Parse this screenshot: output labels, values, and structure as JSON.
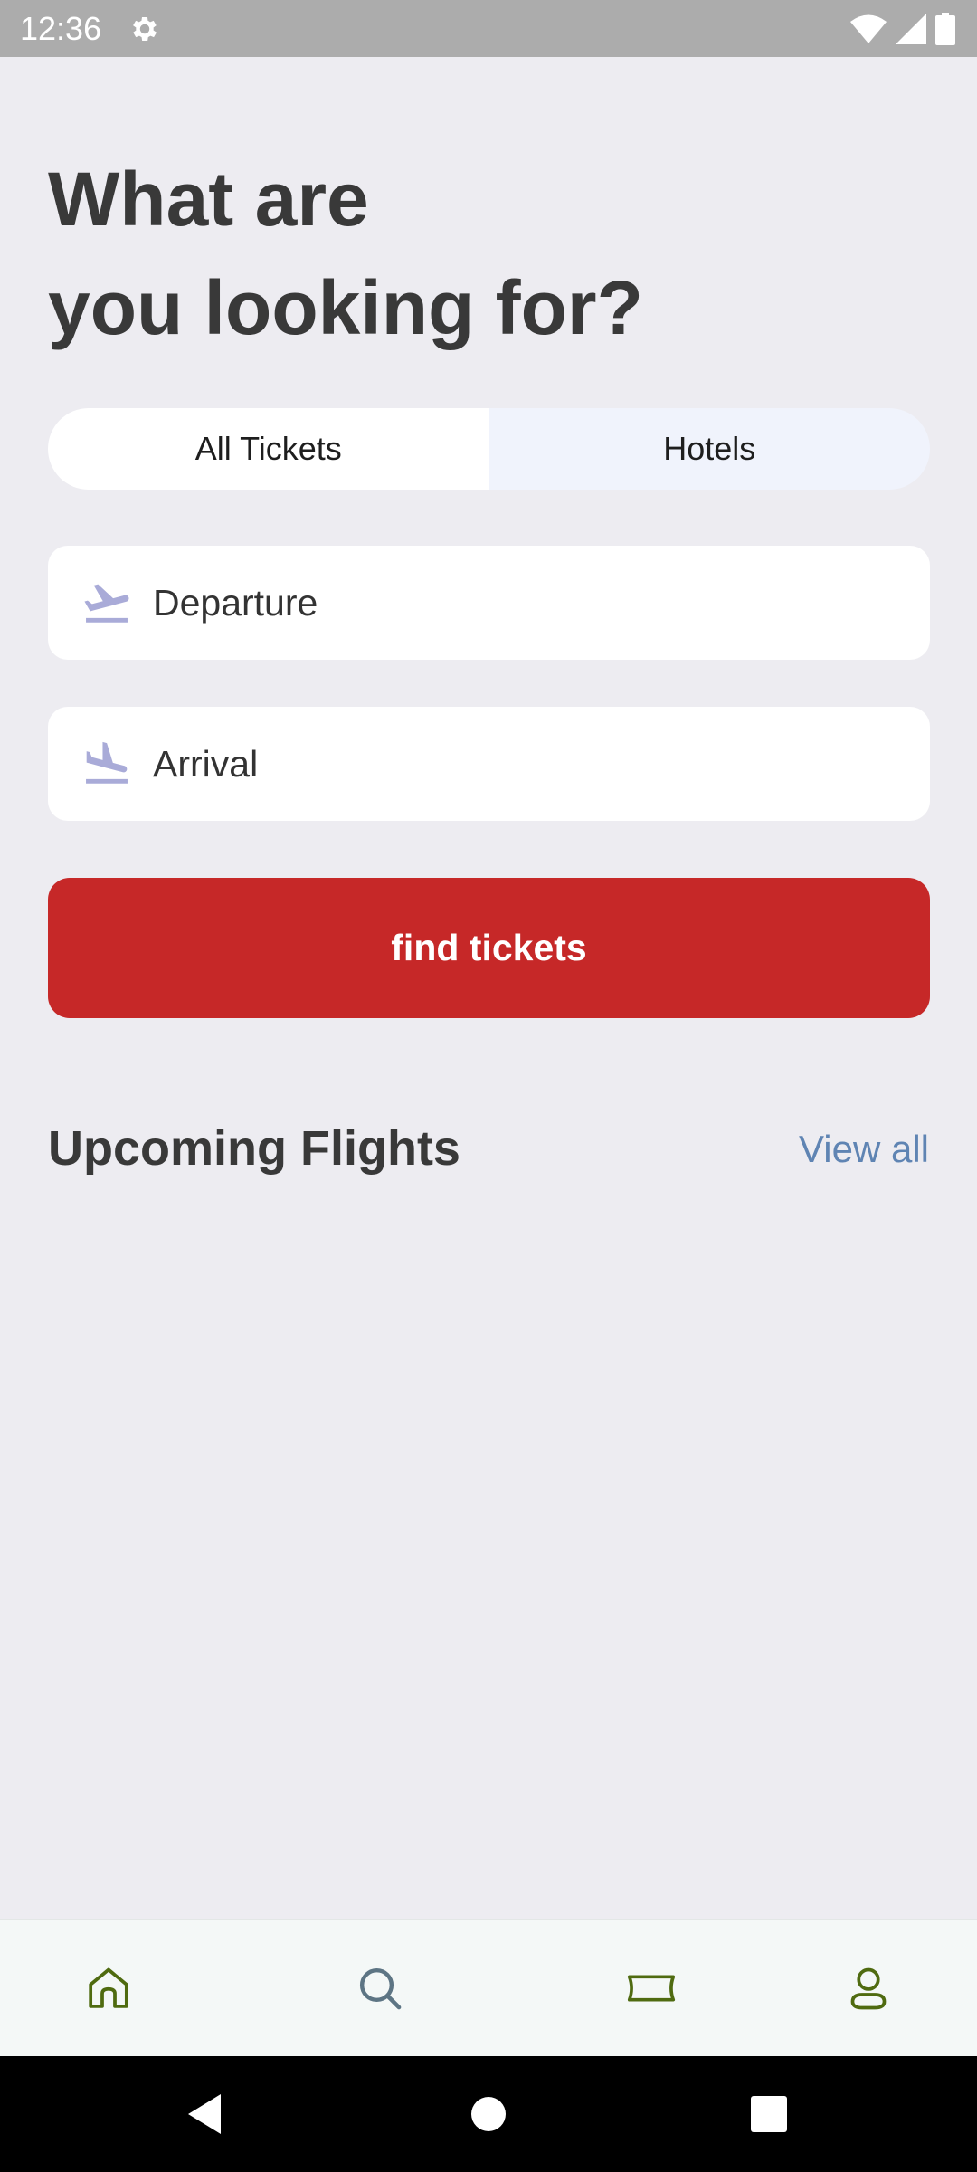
{
  "status_bar": {
    "time": "12:36",
    "icons": [
      "gear-icon",
      "wifi-icon",
      "signal-icon",
      "battery-icon"
    ]
  },
  "header": {
    "title_line1": "What are",
    "title_line2": "you looking for?"
  },
  "tabs": [
    {
      "label": "All Tickets",
      "selected": true
    },
    {
      "label": "Hotels",
      "selected": false
    }
  ],
  "search": {
    "departure_placeholder": "Departure",
    "arrival_placeholder": "Arrival",
    "departure_icon": "flight-takeoff-icon",
    "arrival_icon": "flight-land-icon",
    "find_button_label": "find tickets"
  },
  "upcoming": {
    "title": "Upcoming Flights",
    "view_all_label": "View all"
  },
  "bottom_nav": {
    "items": [
      {
        "icon": "home-icon",
        "active": false
      },
      {
        "icon": "search-icon",
        "active": true
      },
      {
        "icon": "ticket-icon",
        "active": false
      },
      {
        "icon": "profile-icon",
        "active": false
      }
    ]
  },
  "colors": {
    "background": "#edecf1",
    "accent_red": "#c62828",
    "link_blue": "#5f84b3",
    "icon_lavender": "#a9abd8",
    "nav_olive": "#4f6b10",
    "nav_active_slate": "#5d7584"
  }
}
